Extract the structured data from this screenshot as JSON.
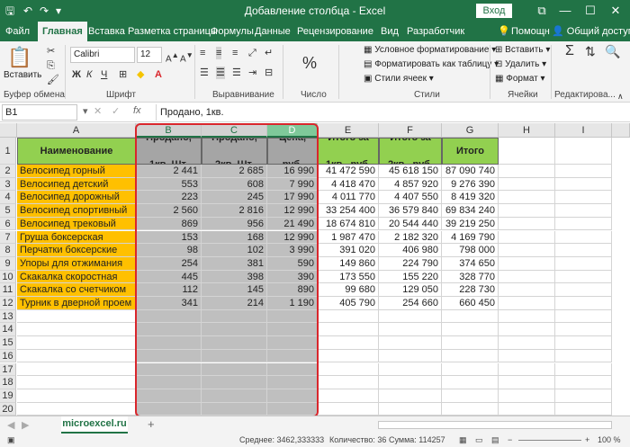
{
  "window": {
    "title": "Добавление столбца  -  Excel",
    "signin": "Вход",
    "restore_label": "⧉",
    "min_label": "—",
    "max_label": "☐",
    "close_label": "✕"
  },
  "tabs": [
    "Файл",
    "Главная",
    "Вставка",
    "Разметка страницы",
    "Формулы",
    "Данные",
    "Рецензирование",
    "Вид",
    "Разработчик"
  ],
  "help": {
    "tell_me": "Помощн",
    "share": "Общий доступ"
  },
  "ribbon": {
    "paste": "Вставить",
    "clipboard_group": "Буфер обмена",
    "font_name": "Calibri",
    "font_size": "12",
    "font_group": "Шрифт",
    "alignment_group": "Выравнивание",
    "number_label": "%",
    "number_group": "Число",
    "cond_format": "Условное форматирование",
    "format_table": "Форматировать как таблицу",
    "cell_styles": "Стили ячеек",
    "styles_group": "Стили",
    "insert": "Вставить",
    "delete": "Удалить",
    "format": "Формат",
    "cells_group": "Ячейки",
    "editing_group": "Редактирова..."
  },
  "formula_bar": {
    "name_box": "B1",
    "fx": "fx",
    "value": "Продано, 1кв."
  },
  "columns": [
    "A",
    "B",
    "C",
    "D",
    "E",
    "F",
    "G",
    "H",
    "I"
  ],
  "rows": [
    "1",
    "2",
    "3",
    "4",
    "5",
    "6",
    "7",
    "8",
    "9",
    "10",
    "11",
    "12",
    "13",
    "14",
    "15",
    "16",
    "17",
    "18",
    "19",
    "20",
    "21"
  ],
  "headers": [
    "Наименование",
    "Продано, 1кв. Шт.",
    "Продано, 2кв. Шт.",
    "Цена, руб.",
    "Итого за 1кв., руб.",
    "Итого за 2кв., руб.",
    "Итого"
  ],
  "table": [
    [
      "Велосипед горный",
      "2 441",
      "2 685",
      "16 990",
      "41 472 590",
      "45 618 150",
      "87 090 740"
    ],
    [
      "Велосипед детский",
      "553",
      "608",
      "7 990",
      "4 418 470",
      "4 857 920",
      "9 276 390"
    ],
    [
      "Велосипед дорожный",
      "223",
      "245",
      "17 990",
      "4 011 770",
      "4 407 550",
      "8 419 320"
    ],
    [
      "Велосипед спортивный",
      "2 560",
      "2 816",
      "12 990",
      "33 254 400",
      "36 579 840",
      "69 834 240"
    ],
    [
      "Велосипед трековый",
      "869",
      "956",
      "21 490",
      "18 674 810",
      "20 544 440",
      "39 219 250"
    ],
    [
      "Груша боксерская",
      "153",
      "168",
      "12 990",
      "1 987 470",
      "2 182 320",
      "4 169 790"
    ],
    [
      "Перчатки боксерские",
      "98",
      "102",
      "3 990",
      "391 020",
      "406 980",
      "798 000"
    ],
    [
      "Упоры для отжимания",
      "254",
      "381",
      "590",
      "149 860",
      "224 790",
      "374 650"
    ],
    [
      "Скакалка скоростная",
      "445",
      "398",
      "390",
      "173 550",
      "155 220",
      "328 770"
    ],
    [
      "Скакалка со счетчиком",
      "112",
      "145",
      "890",
      "99 680",
      "129 050",
      "228 730"
    ],
    [
      "Турник в дверной проем",
      "341",
      "214",
      "1 190",
      "405 790",
      "254 660",
      "660 450"
    ]
  ],
  "sheet_tab": "microexcel.ru",
  "add_sheet": "+",
  "status": {
    "average": "Среднее: 3462,333333",
    "count": "Количество: 36",
    "sum": "Сумма: 114257",
    "zoom": "100 %"
  }
}
